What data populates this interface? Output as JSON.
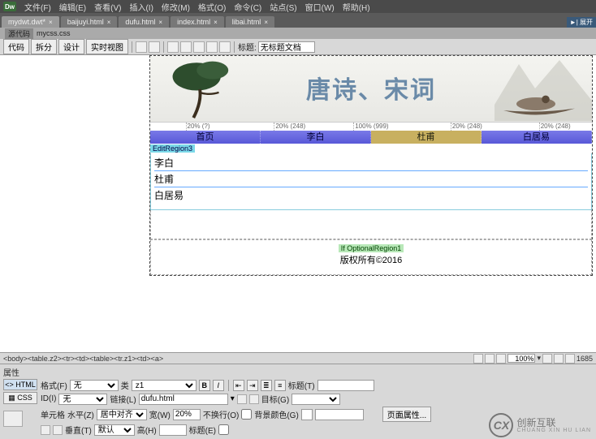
{
  "menubar": {
    "logo": "Dw",
    "items": [
      "文件(F)",
      "编辑(E)",
      "查看(V)",
      "插入(I)",
      "修改(M)",
      "格式(O)",
      "命令(C)",
      "站点(S)",
      "窗口(W)",
      "帮助(H)"
    ]
  },
  "tabs": [
    {
      "label": "mydwt.dwt*",
      "active": true
    },
    {
      "label": "baijuyi.html",
      "active": false
    },
    {
      "label": "dufu.html",
      "active": false
    },
    {
      "label": "index.html",
      "active": false
    },
    {
      "label": "libai.html",
      "active": false
    }
  ],
  "right_collapse": "►| 展开",
  "related": {
    "srcfile": "源代码",
    "file": "mycss.css"
  },
  "viewbar": {
    "code": "代码",
    "split": "拆分",
    "design": "设计",
    "live": "实时视图",
    "title_label": "标题:",
    "title_value": "无标题文档"
  },
  "banner": {
    "title": "唐诗、宋词"
  },
  "ruler_marks": [
    {
      "pos": "8%",
      "t": "20% (?)"
    },
    {
      "pos": "28%",
      "t": "20% (248)"
    },
    {
      "pos": "50%",
      "t": "100% (999)"
    },
    {
      "pos": "70%",
      "t": "20% (248)"
    },
    {
      "pos": "90%",
      "t": "20% (248)"
    }
  ],
  "nav": [
    "首页",
    "李白",
    "杜甫",
    "白居易"
  ],
  "nav_selected_index": 2,
  "edit_region_label": "EditRegion3",
  "content_lines": [
    "李白",
    "杜甫",
    "白居易"
  ],
  "optional_label": "If OptionalRegion1",
  "footer_text": "版权所有©2016",
  "tagpath": "<body><table.z2><tr><td><table><tr.z1><td><a>",
  "zoom": "100%",
  "dims": "1685",
  "props": {
    "header": "属性",
    "mode_html": "<> HTML",
    "mode_css": "▦ CSS",
    "format_label": "格式(F)",
    "format_value": "无",
    "id_label": "ID(I)",
    "id_value": "无",
    "class_label": "类",
    "class_value": "z1",
    "link_label": "链接(L)",
    "link_value": "dufu.html",
    "title_label": "标题(T)",
    "title_value": "",
    "target_label": "目标(G)",
    "target_value": "",
    "cell_label": "单元格",
    "halign_label": "水平(Z)",
    "halign_value": "居中对齐",
    "valign_label": "垂直(T)",
    "valign_value": "默认",
    "width_label": "宽(W)",
    "width_value": "20%",
    "height_label": "高(H)",
    "height_value": "",
    "nowrap_label": "不换行(O)",
    "header_label": "标题(E)",
    "bgcolor_label": "背景颜色(G)",
    "pageprops": "页面属性..."
  },
  "watermark": {
    "logo": "CX",
    "t1": "创新互联",
    "t2": "CHUANG XIN HU LIAN"
  }
}
